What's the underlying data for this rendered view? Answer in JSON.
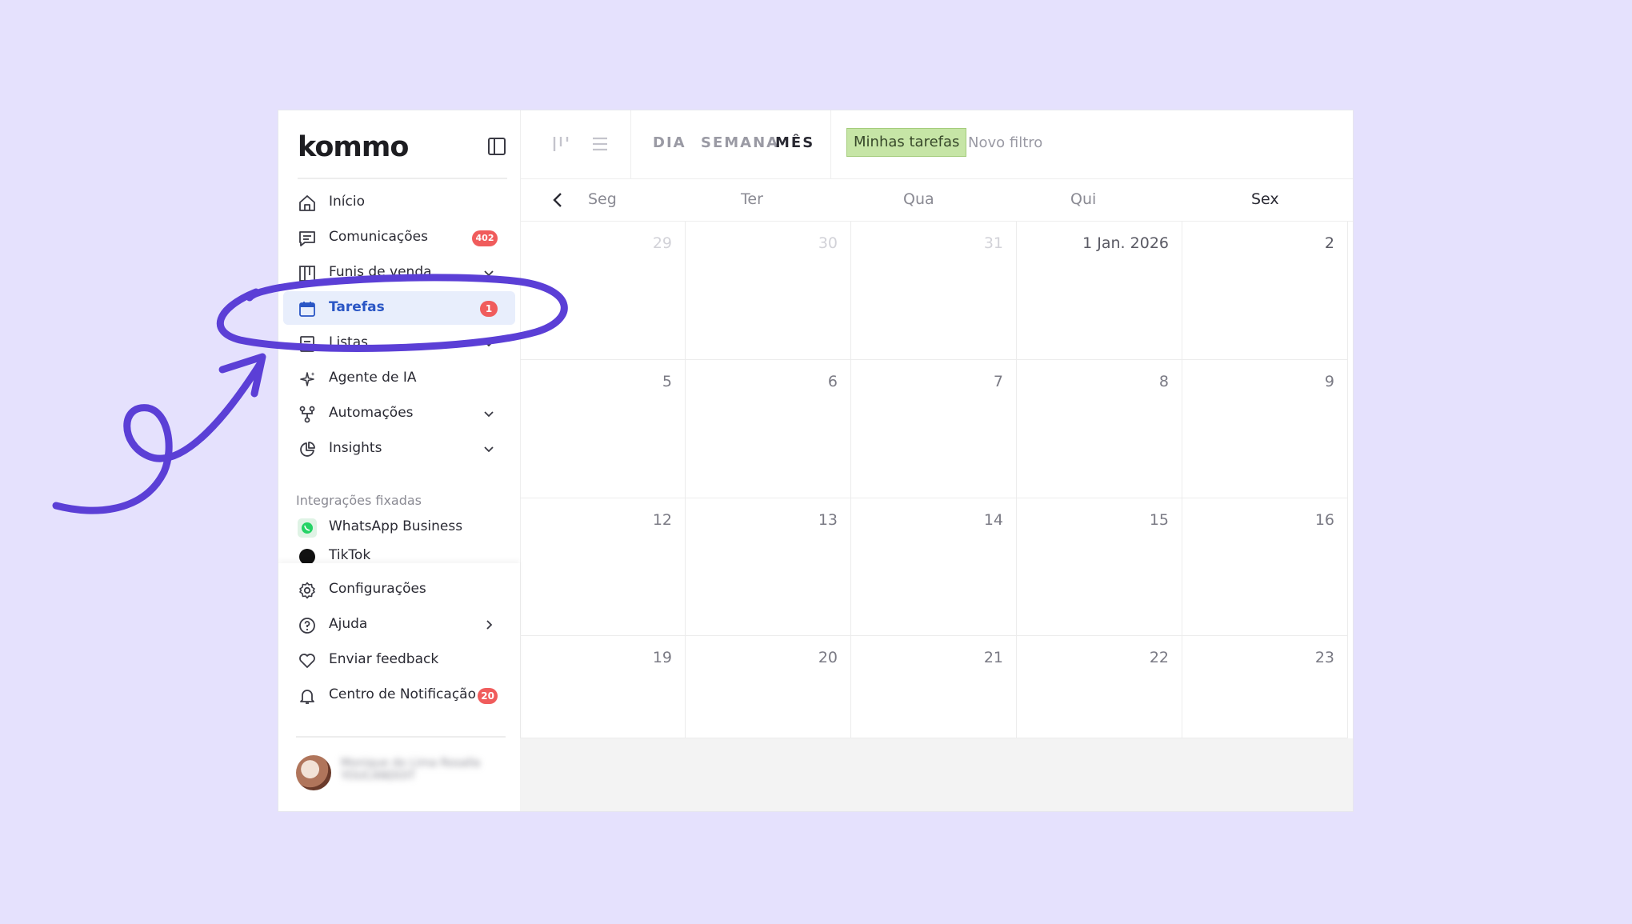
{
  "app": {
    "logo": "kommo",
    "sidebar": {
      "items": [
        {
          "label": "Início",
          "icon": "home-icon"
        },
        {
          "label": "Comunicações",
          "icon": "chat-icon",
          "badge": "402"
        },
        {
          "label": "Funis de venda",
          "icon": "board-icon",
          "chevron": true
        },
        {
          "label": "Tarefas",
          "icon": "calendar-icon",
          "badge": "1",
          "active": true
        },
        {
          "label": "Listas",
          "icon": "list-icon",
          "chevron": true
        },
        {
          "label": "Agente de IA",
          "icon": "sparkles-icon"
        },
        {
          "label": "Automações",
          "icon": "flow-icon",
          "chevron": true
        },
        {
          "label": "Insights",
          "icon": "pie-chart-icon",
          "chevron": true
        }
      ],
      "pinned_title": "Integrações fixadas",
      "pinned": [
        {
          "label": "WhatsApp Business",
          "icon": "whatsapp-icon"
        },
        {
          "label": "TikTok",
          "icon": "tiktok-icon"
        }
      ],
      "bottom": [
        {
          "label": "Configurações",
          "icon": "gear-icon"
        },
        {
          "label": "Ajuda",
          "icon": "help-icon",
          "chevron": true
        },
        {
          "label": "Enviar feedback",
          "icon": "heart-icon"
        },
        {
          "label": "Centro de Notificação",
          "icon": "bell-icon",
          "badge": "20"
        }
      ],
      "user": {
        "name": "Monique do Lima Rosalla",
        "org": "YOUCANDOIT"
      }
    },
    "topbar": {
      "modes": [
        "DIA",
        "SEMANA",
        "MÊS"
      ],
      "active_mode": "MÊS",
      "filter_active": "Minhas tarefas",
      "filter_new": "Novo filtro"
    },
    "calendar": {
      "weekdays": [
        "Seg",
        "Ter",
        "Qua",
        "Qui",
        "Sex"
      ],
      "weeks": [
        [
          "29",
          "30",
          "31",
          "1 Jan. 2026",
          "2"
        ],
        [
          "5",
          "6",
          "7",
          "8",
          "9"
        ],
        [
          "12",
          "13",
          "14",
          "15",
          "16"
        ],
        [
          "19",
          "20",
          "21",
          "22",
          "23"
        ]
      ]
    },
    "colors": {
      "background": "#e5e1fd",
      "annotation": "#5b3fd6",
      "badge": "#f05c5c",
      "active_nav": "#e8eefc",
      "filter": "#c6e5a6"
    }
  }
}
